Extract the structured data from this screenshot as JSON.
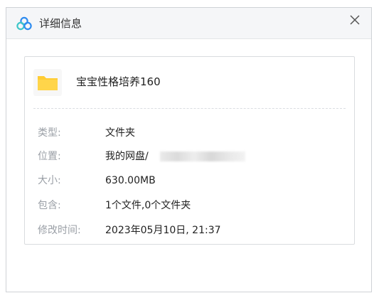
{
  "window": {
    "title": "详细信息",
    "icon": "baidu-netdisk-cloud-icon",
    "close_glyph": "✕"
  },
  "file": {
    "icon": "folder-icon",
    "name": "宝宝性格培养160"
  },
  "details": [
    {
      "label": "类型:",
      "value": "文件夹"
    },
    {
      "label": "位置:",
      "value": "我的网盘/"
    },
    {
      "label": "大小:",
      "value": "630.00MB"
    },
    {
      "label": "包含:",
      "value": "1个文件,0个文件夹"
    },
    {
      "label": "修改时间:",
      "value": "2023年05月10日, 21:37"
    }
  ],
  "colors": {
    "folder": "#ffcc33",
    "label_text": "#9a9fa6",
    "value_text": "#222222",
    "icon_blue": "#2e8cf0",
    "icon_teal": "#3ec6c8"
  }
}
